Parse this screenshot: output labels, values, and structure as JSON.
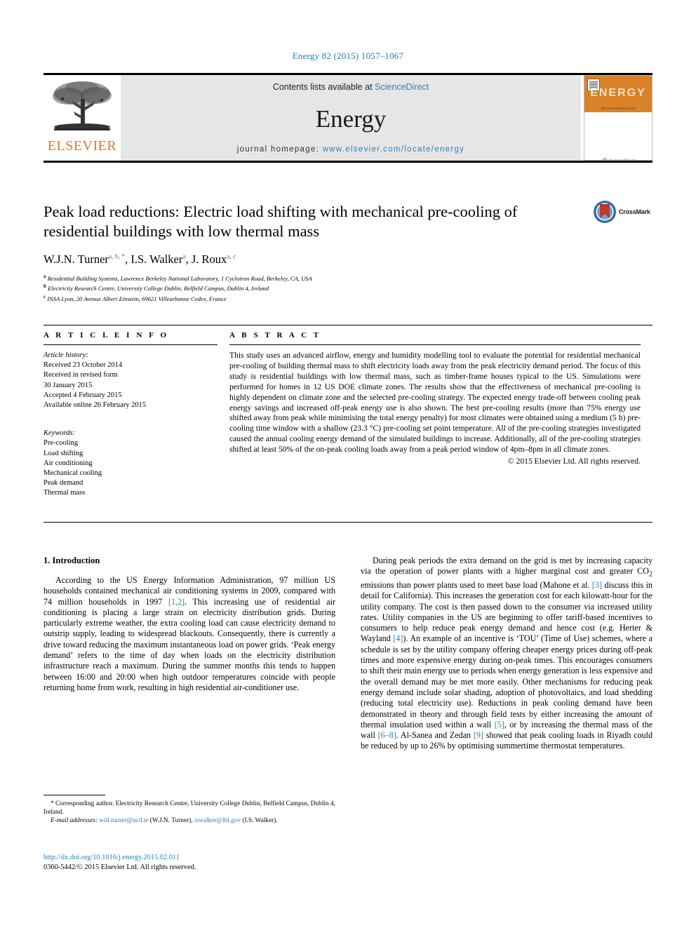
{
  "running_head": "Energy 82 (2015) 1057–1067",
  "masthead": {
    "contents_prefix": "Contents lists available at ",
    "sciencedirect": "ScienceDirect",
    "journal_name": "Energy",
    "homepage_prefix": "journal homepage: ",
    "homepage_url": "www.elsevier.com/locate/energy",
    "publisher": "ELSEVIER",
    "cover_title": "ENERGY",
    "cover_subtitle": "The International Journal",
    "cover_footer": "Available online at\nScienceDirect\nwww.sciencedirect.com"
  },
  "crossmark": {
    "label": "CrossMark"
  },
  "article": {
    "title": "Peak load reductions: Electric load shifting with mechanical pre-cooling of residential buildings with low thermal mass",
    "authors": [
      {
        "name": "W.J.N. Turner",
        "marks": "a, b, *"
      },
      {
        "name": "I.S. Walker",
        "marks": "a"
      },
      {
        "name": "J. Roux",
        "marks": "a, c"
      }
    ],
    "affiliations": [
      {
        "mark": "a",
        "text": "Residential Building Systems, Lawrence Berkeley National Laboratory, 1 Cyclotron Road, Berkeley, CA, USA"
      },
      {
        "mark": "b",
        "text": "Electricity Research Centre, University College Dublin, Belfield Campus, Dublin 4, Ireland"
      },
      {
        "mark": "c",
        "text": "INSA Lyon, 20 Avenue Albert Einstein, 69621 Villeurbanne Cedex, France"
      }
    ]
  },
  "article_info": {
    "heading": "A R T I C L E  I N F O",
    "history_label": "Article history:",
    "history": [
      "Received 23 October 2014",
      "Received in revised form",
      "30 January 2015",
      "Accepted 4 February 2015",
      "Available online 26 February 2015"
    ],
    "keywords_label": "Keywords:",
    "keywords": [
      "Pre-cooling",
      "Load shifting",
      "Air conditioning",
      "Mechanical cooling",
      "Peak demand",
      "Thermal mass"
    ]
  },
  "abstract": {
    "heading": "A B S T R A C T",
    "text": "This study uses an advanced airflow, energy and humidity modelling tool to evaluate the potential for residential mechanical pre-cooling of building thermal mass to shift electricity loads away from the peak electricity demand period. The focus of this study is residential buildings with low thermal mass, such as timber-frame houses typical to the US. Simulations were performed for homes in 12 US DOE climate zones. The results show that the effectiveness of mechanical pre-cooling is highly dependent on climate zone and the selected pre-cooling strategy. The expected energy trade-off between cooling peak energy savings and increased off-peak energy use is also shown. The best pre-cooling results (more than 75% energy use shifted away from peak while minimising the total energy penalty) for most climates were obtained using a medium (5 h) pre-cooling time window with a shallow (23.3 °C) pre-cooling set point temperature. All of the pre-cooling strategies investigated caused the annual cooling energy demand of the simulated buildings to increase. Additionally, all of the pre-cooling strategies shifted at least 50% of the on-peak cooling loads away from a peak period window of 4pm–8pm in all climate zones.",
    "copyright": "© 2015 Elsevier Ltd. All rights reserved."
  },
  "body": {
    "section_number_title": "1. Introduction",
    "left_paragraph_1": "According to the US Energy Information Administration, 97 million US households contained mechanical air conditioning systems in 2009, compared with 74 million households in 1997 ",
    "left_cite_1": "[1,2]",
    "left_paragraph_1b": ". This increasing use of residential air conditioning is placing a large strain on electricity distribution grids. During particularly extreme weather, the extra cooling load can cause electricity demand to outstrip supply, leading to widespread blackouts. Consequently, there is currently a drive toward reducing the maximum instantaneous load on power grids. ‘Peak energy demand’ refers to the time of day when loads on the electricity distribution infrastructure reach a maximum. During the summer months this tends to happen between 16:00 and 20:00 when high outdoor temperatures coincide with people returning home from work, resulting in high residential air-conditioner use.",
    "right_p1_a": "During peak periods the extra demand on the grid is met by increasing capacity via the operation of power plants with a higher marginal cost and greater CO",
    "right_p1_sub": "2",
    "right_p1_b": " emissions than power plants used to meet base load (Mahone et al. ",
    "right_cite_3": "[3]",
    "right_p1_c": " discuss this in detail for California). This increases the generation cost for each kilowatt-hour for the utility company. The cost is then passed down to the consumer via increased utility rates. Utility companies in the US are beginning to offer tariff-based incentives to consumers to help reduce peak energy demand and hence cost (e.g. Herter & Wayland ",
    "right_cite_4": "[4]",
    "right_p1_d": "). An example of an incentive is ‘TOU’ (Time of Use) schemes, where a schedule is set by the utility company offering cheaper energy prices during off-peak times and more expensive energy during on-peak times. This encourages consumers to shift their main energy use to periods when energy generation is less expensive and the overall demand may be met more easily. Other mechanisms for reducing peak energy demand include solar shading, adoption of photovoltaics, and load shedding (reducing total electricity use). Reductions in peak cooling demand have been demonstrated in theory and through field tests by either increasing the amount of thermal insulation used within a wall ",
    "right_cite_5": "[5]",
    "right_p1_e": ", or by increasing the thermal mass of the wall ",
    "right_cite_68": "[6–8]",
    "right_p1_f": ". Al-Sanea and Zedan ",
    "right_cite_9": "[9]",
    "right_p1_g": " showed that peak cooling loads in Riyadh could be reduced by up to 26% by optimising summertime thermostat temperatures."
  },
  "footnotes": {
    "corresponding": "* Corresponding author. Electricity Research Centre, University College Dublin, Belfield Campus, Dublin 4, Ireland.",
    "email_label": "E-mail addresses:",
    "email_1": "will.turner@ucd.ie",
    "email_1_owner": " (W.J.N. Turner), ",
    "email_2": "iswalker@lbl.gov",
    "email_2_owner": " (I.S. Walker)."
  },
  "footer": {
    "doi": "http://dx.doi.org/10.1016/j.energy.2015.02.011",
    "issn_line": "0360-5442/© 2015 Elsevier Ltd. All rights reserved."
  },
  "colors": {
    "link_blue": "#2c7fb8",
    "elsevier_orange": "#E87722",
    "masthead_grey": "#e6e6e6",
    "cover_orange": "#d98227"
  }
}
